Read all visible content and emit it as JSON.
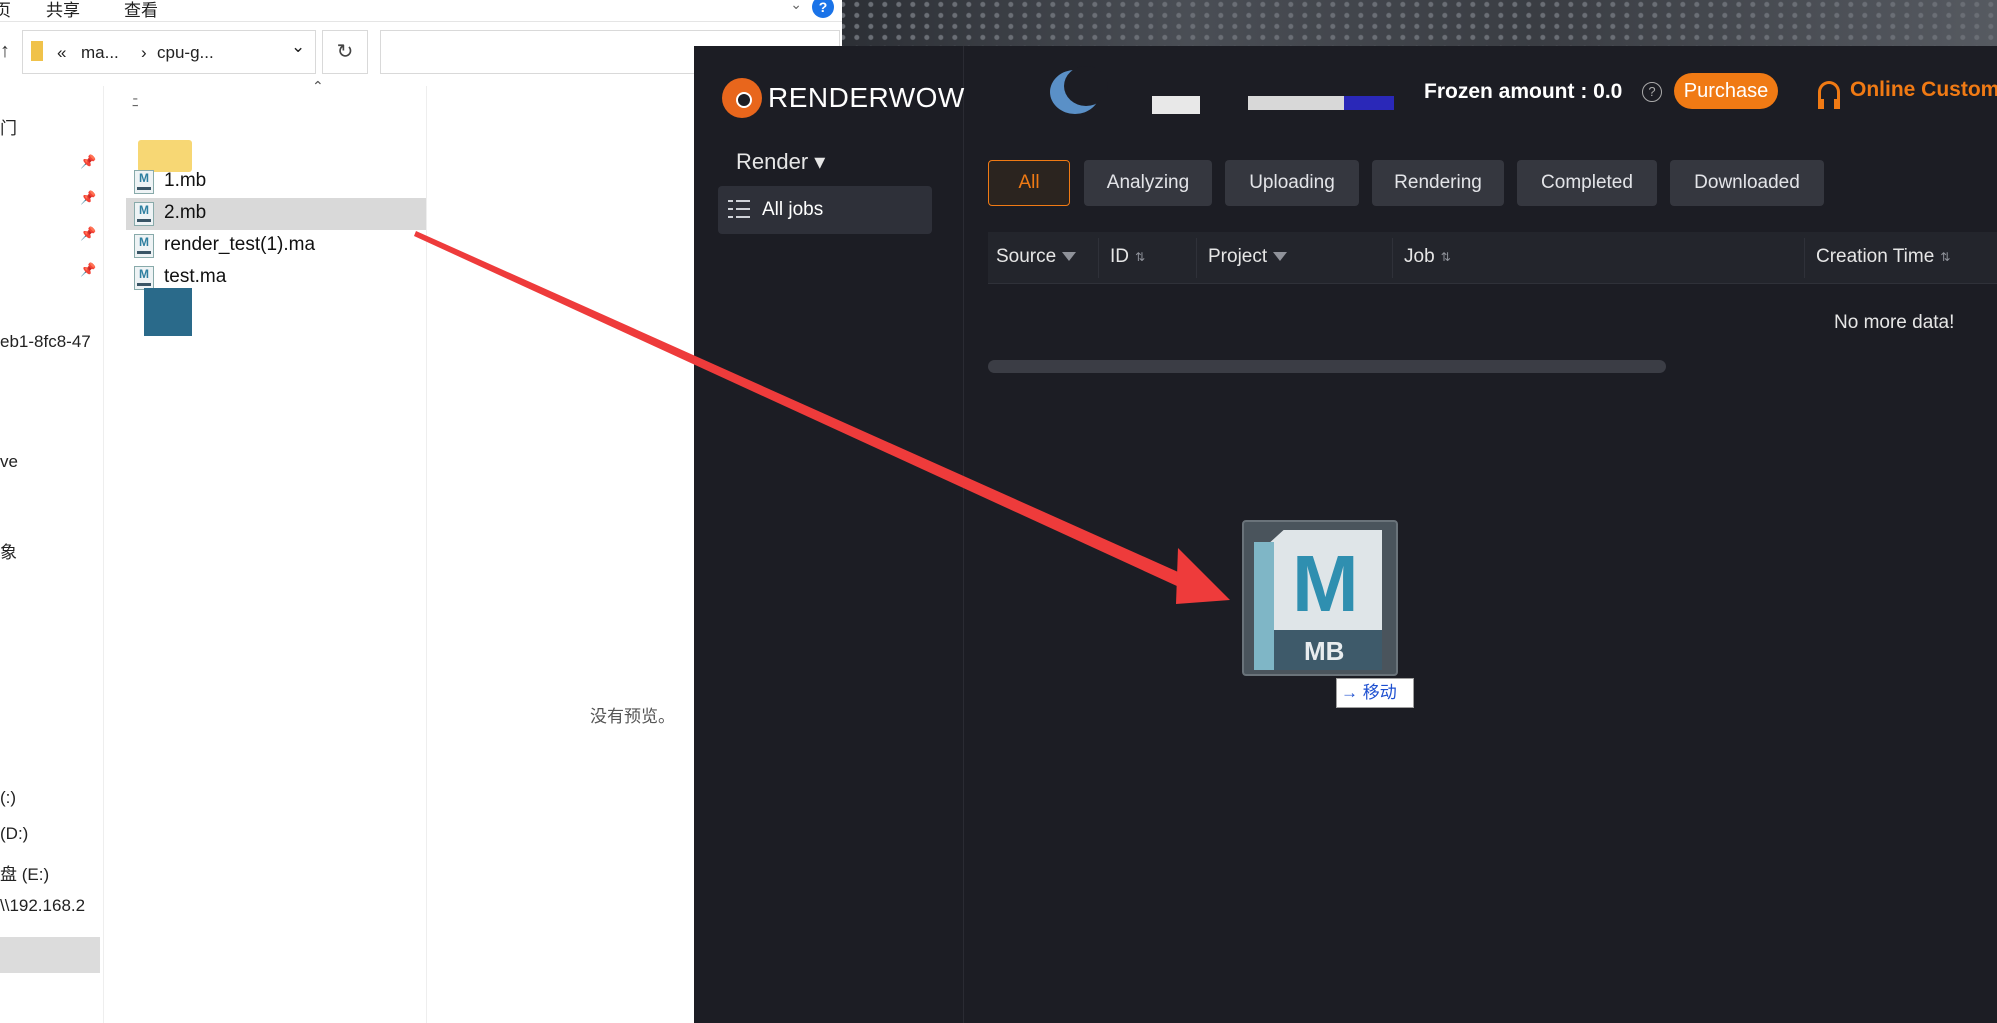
{
  "explorer": {
    "ribbon": {
      "tab_home": "页",
      "tab_share": "共享",
      "tab_view": "查看",
      "help_icon": "?"
    },
    "nav_up_icon": "↑",
    "breadcrumb": {
      "overflow": "«",
      "folder1": "ma...",
      "sep": "›",
      "folder2": "cpu-g...",
      "dropdown_icon": "⌄"
    },
    "refresh_icon": "↻",
    "sort_caret_icon": "⌃",
    "sort_glyph_icon": "ﾆ",
    "nav_items": [
      "门",
      "eb1-8fc8-47",
      "ve",
      "象",
      "(:)",
      "(D:)",
      "盘 (E:)",
      "\\\\192.168.2"
    ],
    "pin_icon": "📌",
    "files": [
      {
        "name": "1.mb",
        "icon": "M"
      },
      {
        "name": "2.mb",
        "icon": "M"
      },
      {
        "name": "render_test(1).ma",
        "icon": "M"
      },
      {
        "name": "test.ma",
        "icon": "M"
      }
    ],
    "no_preview_text": "没有预览。"
  },
  "app": {
    "logo_text": "RENDERWOW",
    "render_menu": "Render ▾",
    "all_jobs": "All jobs",
    "frozen_amount_label": "Frozen amount : 0.0",
    "frozen_help_icon": "?",
    "purchase_label": "Purchase",
    "online_service_label": "Online Custom",
    "tabs": [
      "All",
      "Analyzing",
      "Uploading",
      "Rendering",
      "Completed",
      "Downloaded"
    ],
    "active_tab": "All",
    "columns": [
      "Source",
      "ID",
      "Project",
      "Job",
      "Creation Time"
    ],
    "empty_text": "No more data!",
    "accent_color": "#f07a14"
  },
  "drag": {
    "icon_letter": "M",
    "icon_badge": "MB",
    "tooltip_arrow": "→",
    "tooltip_text": "移动"
  }
}
